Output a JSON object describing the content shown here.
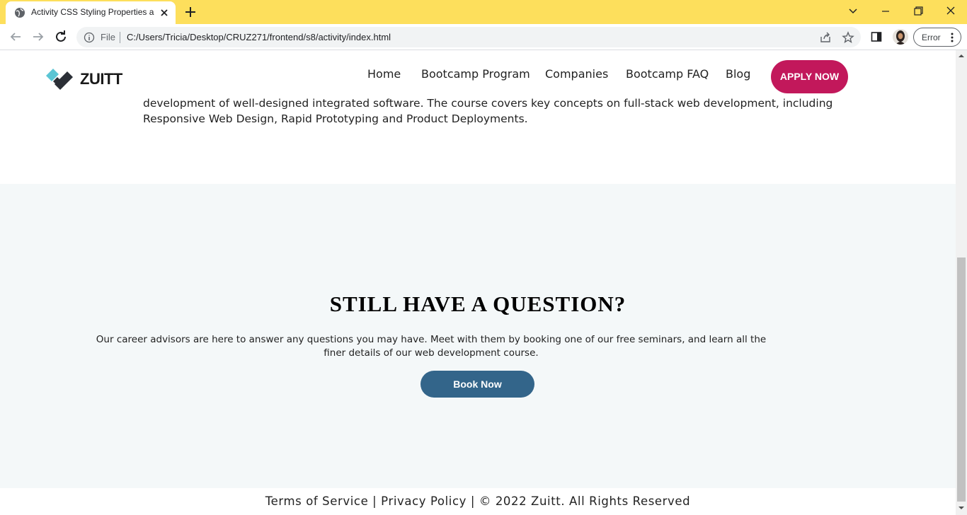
{
  "browser": {
    "tab": {
      "title": "Activity CSS Styling Properties and Flexbox"
    },
    "omnibox": {
      "scheme_label": "File",
      "url": "C:/Users/Tricia/Desktop/CRUZ271/frontend/s8/activity/index.html"
    },
    "profile": {
      "error_label": "Error"
    }
  },
  "page": {
    "intro_text": "development of well-designed integrated software. The course covers key concepts on full-stack web development, including Responsive Web Design, Rapid Prototyping and Product Deployments.",
    "navbar": {
      "brand": "ZUITT",
      "links": [
        "Home",
        "Bootcamp Program",
        "Companies",
        "Bootcamp FAQ",
        "Blog"
      ],
      "cta": "APPLY NOW"
    },
    "question": {
      "heading": "STILL HAVE A QUESTION?",
      "text": "Our career advisors are here to answer any questions you may have. Meet with them by booking one of our free seminars, and learn all the finer details of our web development course.",
      "button": "Book Now"
    },
    "footer": {
      "text": "Terms of Service | Privacy Policy | © 2022 Zuitt. All Rights Reserved"
    }
  },
  "colors": {
    "tabstrip": "#fddf5c",
    "apply_button": "#c2185b",
    "book_button": "#33658a",
    "question_bg": "#f4f8f9"
  }
}
